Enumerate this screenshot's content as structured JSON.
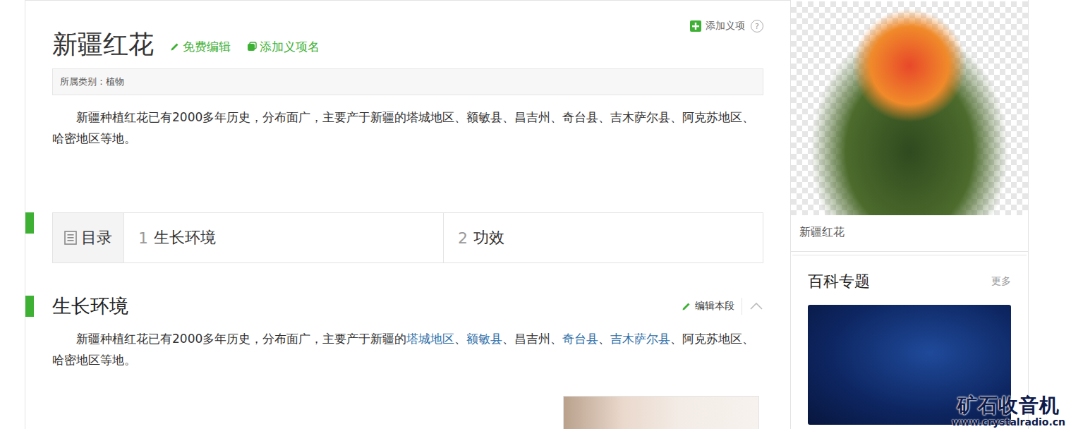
{
  "title": "新疆红花",
  "header_links": [
    {
      "label": "免费编辑",
      "kind": "edit"
    },
    {
      "label": "添加义项名",
      "kind": "add-name"
    }
  ],
  "add_item": {
    "label": "添加义项",
    "help": "?"
  },
  "category": "所属类别：植物",
  "summary": "新疆种植红花已有2000多年历史，分布面广，主要产于新疆的塔城地区、额敏县、昌吉州、奇台县、吉木萨尔县、阿克苏地区、哈密地区等地。",
  "catalog": {
    "label": "目录",
    "items": [
      {
        "number": "1",
        "label": "生长环境"
      },
      {
        "number": "2",
        "label": "功效"
      }
    ]
  },
  "section": {
    "title": "生长环境",
    "edit": "编辑本段",
    "expanded": true,
    "paragraph": [
      {
        "text": "新疆种植红花已有2000多年历史，分布面广，主要产于新疆的",
        "link": false
      },
      {
        "text": "塔城地区",
        "link": true
      },
      {
        "text": "、",
        "link": false
      },
      {
        "text": "额敏县",
        "link": true
      },
      {
        "text": "、昌吉州、",
        "link": false
      },
      {
        "text": "奇台县",
        "link": true
      },
      {
        "text": "、",
        "link": false
      },
      {
        "text": "吉木萨尔县",
        "link": true
      },
      {
        "text": "、阿克苏地区、哈密地区等地。",
        "link": false
      }
    ]
  },
  "sidebar": {
    "caption": "新疆红花",
    "topics": {
      "title": "百科专题",
      "more": "更多"
    }
  },
  "watermark": {
    "name": "矿石收音机",
    "url": "www.crystalradio.cn"
  }
}
